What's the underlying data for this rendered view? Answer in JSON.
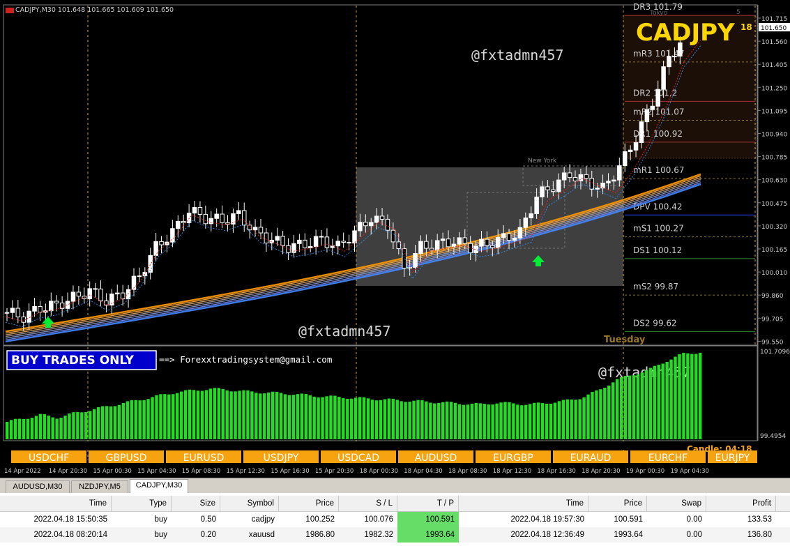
{
  "chart_header": {
    "symbol_info": "CADJPY,M30  101.648 101.665 101.609 101.650",
    "big_symbol": "CADJPY",
    "countdown": "18",
    "watermark": "@fxtadmn457",
    "buy_label": "BUY TRADES ONLY",
    "email_note": "==> Forexxtradingsystem@gmail.com",
    "session_tokyo": "Tokyo",
    "session_newyork": "New York",
    "session_5": "5",
    "day_label": "Tuesday",
    "candle_label": "Candle:",
    "candle_time": "04:18",
    "current_price": "101.650"
  },
  "pivot_levels": [
    {
      "label": "DR3",
      "value": "101.79",
      "price": 101.79
    },
    {
      "label": "mR3",
      "value": "101.47",
      "price": 101.47
    },
    {
      "label": "DR2",
      "value": "101.2",
      "price": 101.2
    },
    {
      "label": "mR2",
      "value": "101.07",
      "price": 101.07
    },
    {
      "label": "DR1",
      "value": "100.92",
      "price": 100.92
    },
    {
      "label": "mR1",
      "value": "100.67",
      "price": 100.67
    },
    {
      "label": "DPV",
      "value": "100.42",
      "price": 100.42
    },
    {
      "label": "mS1",
      "value": "100.27",
      "price": 100.27
    },
    {
      "label": "DS1",
      "value": "100.12",
      "price": 100.12
    },
    {
      "label": "mS2",
      "value": "99.87",
      "price": 99.87
    },
    {
      "label": "DS2",
      "value": "99.62",
      "price": 99.62
    }
  ],
  "price_axis": [
    "101.715",
    "101.560",
    "101.405",
    "101.250",
    "101.095",
    "100.940",
    "100.785",
    "100.630",
    "100.475",
    "100.320",
    "100.165",
    "100.010",
    "99.860",
    "99.705",
    "99.550"
  ],
  "indicator_axis": {
    "top": "101.7096",
    "bottom": "99.4954"
  },
  "time_axis": [
    "14 Apr 2022",
    "14 Apr 20:30",
    "15 Apr 00:30",
    "15 Apr 04:30",
    "15 Apr 08:30",
    "15 Apr 12:30",
    "15 Apr 16:30",
    "15 Apr 20:30",
    "18 Apr 00:30",
    "18 Apr 04:30",
    "18 Apr 08:30",
    "18 Apr 12:30",
    "18 Apr 16:30",
    "18 Apr 20:30",
    "19 Apr 00:30",
    "19 Apr 04:30"
  ],
  "pair_buttons": [
    "USDCHF",
    "GBPUSD",
    "EURUSD",
    "USDJPY",
    "USDCAD",
    "AUDUSD",
    "EURGBP",
    "EURAUD",
    "EURCHF",
    "EURJPY"
  ],
  "tabs": [
    {
      "label": "AUDUSD,M30",
      "active": false
    },
    {
      "label": "NZDJPY,M5",
      "active": false
    },
    {
      "label": "CADJPY,M30",
      "active": true
    }
  ],
  "terminal": {
    "columns": [
      "Time",
      "Type",
      "Size",
      "Symbol",
      "Price",
      "S / L",
      "T / P",
      "Time",
      "Price",
      "Swap",
      "Profit"
    ],
    "rows": [
      [
        "2022.04.18 15:50:35",
        "buy",
        "0.50",
        "cadjpy",
        "100.252",
        "100.076",
        "100.591",
        "2022.04.18 19:57:30",
        "100.591",
        "0.00",
        "133.53"
      ],
      [
        "2022.04.18 08:20:14",
        "buy",
        "0.20",
        "xauusd",
        "1986.80",
        "1982.32",
        "1993.64",
        "2022.04.18 12:36:49",
        "1993.64",
        "0.00",
        "136.80"
      ]
    ]
  },
  "colors": {
    "bull_candle": "#ffffff",
    "histogram": "#22dd22",
    "ma_ribbon_top": "#ff9900",
    "ma_ribbon_bottom": "#4488ff",
    "pivot_line": "#aa3333",
    "accent_yellow": "#ffd700",
    "button_orange": "#f7a30f",
    "tp_highlight": "#66dd66"
  },
  "chart_data": {
    "type": "candlestick",
    "title": "CADJPY,M30",
    "ylim": [
      99.55,
      101.8
    ],
    "close_path": [
      99.75,
      99.72,
      99.78,
      99.8,
      99.85,
      99.9,
      99.83,
      99.88,
      100.0,
      100.2,
      100.3,
      100.45,
      100.4,
      100.38,
      100.42,
      100.3,
      100.25,
      100.2,
      100.22,
      100.25,
      100.2,
      100.3,
      100.4,
      100.35,
      100.05,
      100.2,
      100.22,
      100.24,
      100.2,
      100.22,
      100.26,
      100.3,
      100.55,
      100.62,
      100.7,
      100.65,
      100.6,
      100.75,
      100.95,
      101.2,
      101.5,
      101.65
    ],
    "histogram_values": [
      20,
      24,
      28,
      25,
      30,
      34,
      38,
      42,
      46,
      50,
      54,
      56,
      58,
      57,
      55,
      54,
      53,
      52,
      50,
      49,
      48,
      47,
      46,
      45,
      44,
      43,
      42,
      41,
      40,
      42,
      41,
      40,
      42,
      44,
      48,
      56,
      68,
      74,
      80,
      90,
      98,
      100
    ],
    "histogram_range": [
      99.4954,
      101.7096
    ]
  }
}
